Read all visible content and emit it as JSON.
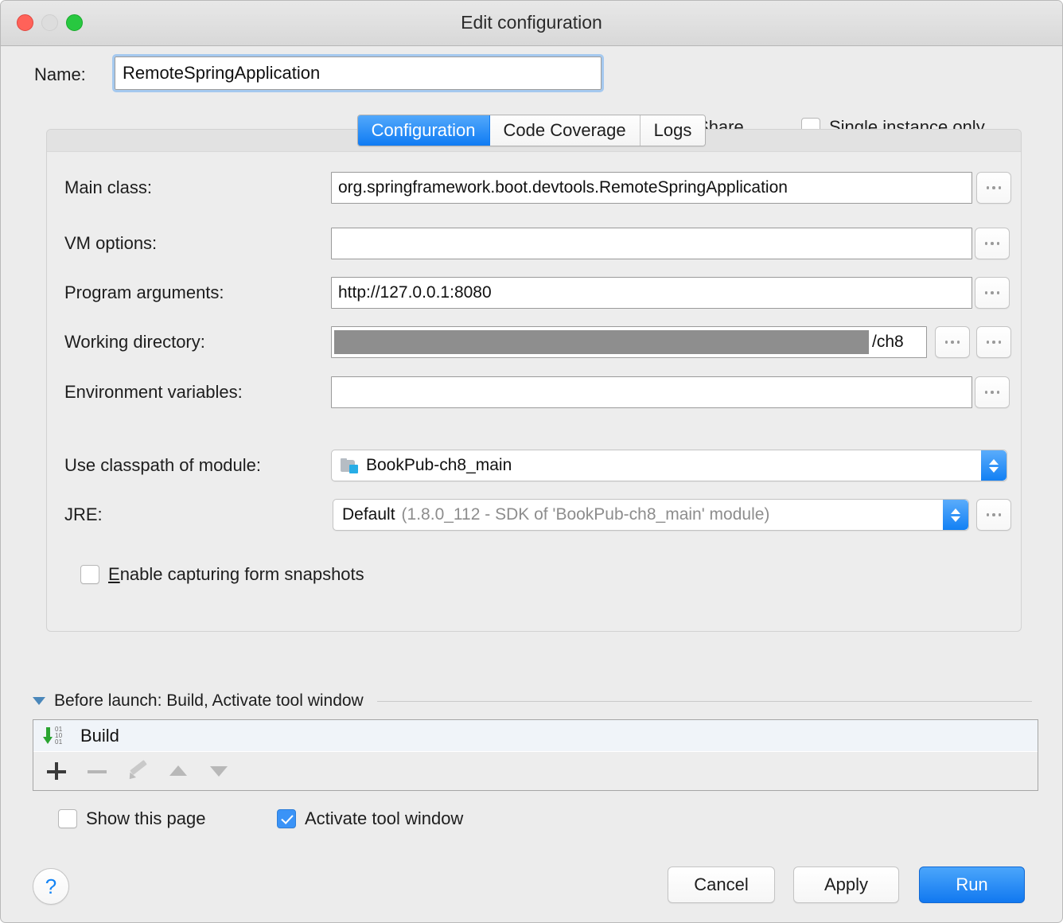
{
  "window": {
    "title": "Edit configuration",
    "traffic_lights": [
      "close-button",
      "minimize-button",
      "zoom-button"
    ]
  },
  "name_row": {
    "label": "Name:",
    "value": "RemoteSpringApplication",
    "share": {
      "label_prefix": "S",
      "label_rest": "hare",
      "checked": false
    },
    "single_instance": {
      "label_prefix": "Single ",
      "label_mnemonic": "i",
      "label_rest": "nstance only",
      "checked": false
    }
  },
  "tabs": [
    {
      "label": "Configuration",
      "active": true
    },
    {
      "label": "Code Coverage",
      "active": false
    },
    {
      "label": "Logs",
      "active": false
    }
  ],
  "form": {
    "main_class": {
      "label": "Main class:",
      "value": "org.springframework.boot.devtools.RemoteSpringApplication",
      "browse": "..."
    },
    "vm_options": {
      "label": "VM options:",
      "value": "",
      "browse": "..."
    },
    "program_arguments": {
      "label": "Program arguments:",
      "value": "http://127.0.0.1:8080",
      "browse": "..."
    },
    "working_directory": {
      "label": "Working directory:",
      "value_suffix": "/ch8",
      "browse": "...",
      "browse2": "..."
    },
    "environment_variables": {
      "label": "Environment variables:",
      "value": "",
      "browse": "..."
    },
    "module": {
      "label": "Use classpath of module:",
      "value": "BookPub-ch8_main"
    },
    "jre": {
      "label": "JRE:",
      "value": "Default",
      "value_detail": "(1.8.0_112 - SDK of 'BookPub-ch8_main' module)",
      "browse": "..."
    },
    "form_snapshots": {
      "label_prefix": "E",
      "label_rest": "nable capturing form snapshots",
      "checked": false
    }
  },
  "before_launch": {
    "title": "Before launch: Build, Activate tool window",
    "items": [
      {
        "label": "Build",
        "icon_bits": [
          "01",
          "10",
          "01"
        ]
      }
    ],
    "toolbar": [
      "add",
      "remove",
      "edit",
      "move-up",
      "move-down"
    ],
    "show_this_page": {
      "label": "Show this page",
      "checked": false
    },
    "activate_tool_window": {
      "label": "Activate tool window",
      "checked": true
    }
  },
  "footer": {
    "help": "?",
    "cancel": "Cancel",
    "apply": "Apply",
    "run": "Run"
  },
  "colors": {
    "accent_blue": "#1178f0",
    "window_bg": "#ececec",
    "panel_bg": "#ededed",
    "selection_row": "#f0f4f9",
    "build_green": "#2aa431",
    "traffic_red": "#ff6259",
    "traffic_green": "#28c840"
  }
}
